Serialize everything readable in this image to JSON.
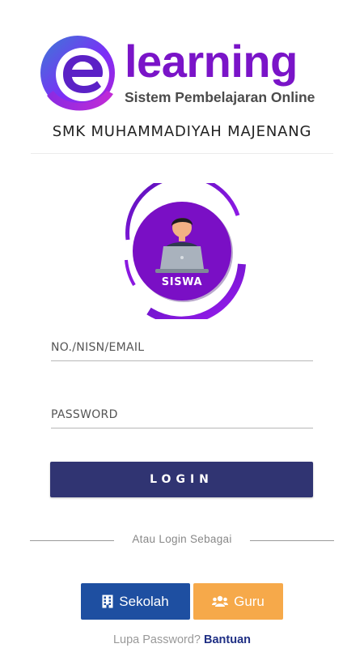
{
  "brand": {
    "word": "learning",
    "tagline": "Sistem Pembelajaran Online",
    "logo_icon": "e-letter-logo-icon"
  },
  "school": {
    "name": "SMK MUHAMMADIYAH MAJENANG"
  },
  "role": {
    "label": "SISWA",
    "icon": "student-laptop-icon"
  },
  "form": {
    "username_placeholder": "NO./NISN/EMAIL",
    "password_placeholder": "PASSWORD",
    "login_label": "LOGIN"
  },
  "alt_login": {
    "text": "Atau Login Sebagai",
    "sekolah_label": "Sekolah",
    "guru_label": "Guru"
  },
  "footer": {
    "prompt": "Lupa Password?",
    "help_link": "Bantuan"
  },
  "colors": {
    "brand_purple": "#7a14c8",
    "login_button": "#303472",
    "sekolah_button": "#1e4fa1",
    "guru_button": "#f6a94a",
    "help_link": "#1f2f84"
  }
}
